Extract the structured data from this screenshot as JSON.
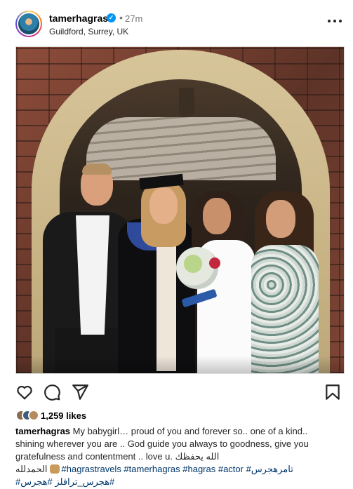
{
  "post": {
    "username": "tamerhagras",
    "verified_mark": "✓",
    "separator": "•",
    "time": "27m",
    "location": "Guildford, Surrey, UK"
  },
  "actions": {
    "like_icon": "heart-icon",
    "comment_icon": "comment-icon",
    "share_icon": "paper-plane-icon",
    "save_icon": "bookmark-icon"
  },
  "likes": {
    "count_label": "1,259 likes"
  },
  "caption": {
    "username": "tamerhagras",
    "line1": "My babygirl… proud of you and forever so.. one of a kind..",
    "line2": "shining wherever you are .. God guide you always to goodness, give you",
    "line3_text": "gratefulness and contentment .. love u. ",
    "line3_arabic": "الله يحفظك",
    "line4_arabic": "الحمدلله",
    "line4_tags": "#hagrastravels #tamerhagras #hagras #actor #تامرهجرس",
    "line5_tags": "#هجرس_ترافلز #هجرس#"
  },
  "colors": {
    "verified": "#0095f6",
    "hashtag": "#00376b",
    "muted": "#737373"
  }
}
